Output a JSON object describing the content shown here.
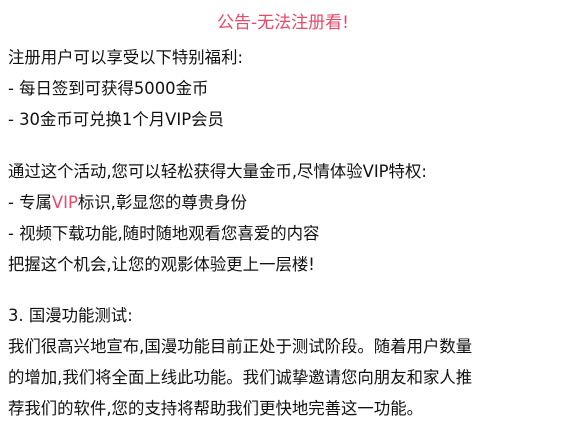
{
  "notice": {
    "title": "公告-无法注册看!",
    "section1": {
      "intro": "注册用户可以享受以下特别福利:",
      "items": [
        "- 每日签到可获得5000金币",
        "- 30金币可兑换1个月VIP会员"
      ]
    },
    "section2": {
      "intro": "通过这个活动,您可以轻松获得大量金币,尽情体验VIP特权:",
      "vip_item": {
        "prefix": "- 专属",
        "highlight": "VIP",
        "suffix": "标识,彰显您的尊贵身份"
      },
      "item2": "- 视频下载功能,随时随地观看您喜爱的内容",
      "closing": "把握这个机会,让您的观影体验更上一层楼!"
    },
    "section3": {
      "heading": "3. 国漫功能测试:",
      "lines": [
        "我们很高兴地宣布,国漫功能目前正处于测试阶段。随着用户数量",
        "的增加,我们将全面上线此功能。我们诚挚邀请您向朋友和家人推",
        "荐我们的软件,您的支持将帮助我们更快地完善这一功能。"
      ]
    }
  },
  "colors": {
    "accent": "#e8486a",
    "text": "#111111",
    "background": "#ffffff"
  }
}
